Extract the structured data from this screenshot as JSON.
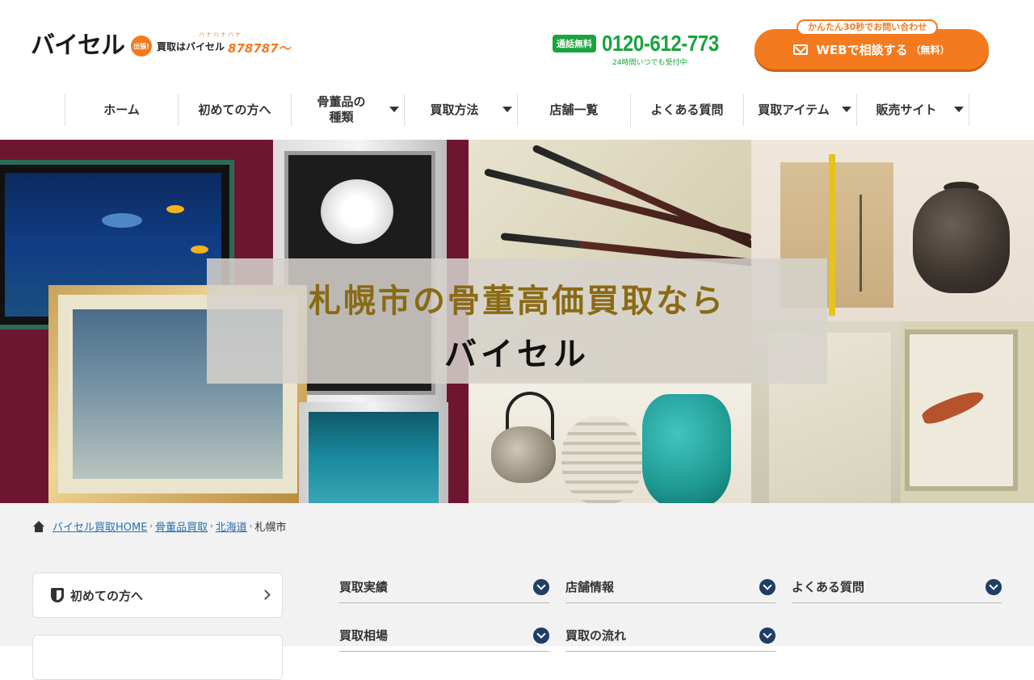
{
  "header": {
    "logo": "バイセル",
    "logo_badge": "出張!",
    "logo_tagline": "買取はバイセル",
    "logo_number": "878787〜",
    "logo_reading": "ハナハナハナ",
    "tel_badge": "通話無料",
    "tel_number": "0120-612-773",
    "tel_note": "24時間いつでも受付中",
    "cta_tag": "かんたん30秒でお問い合わせ",
    "cta_label": "WEBで相談する",
    "cta_sub": "（無料）"
  },
  "nav": {
    "items": [
      {
        "label": "ホーム"
      },
      {
        "label": "初めての方へ"
      },
      {
        "label": "骨董品の種類"
      },
      {
        "label": "買取方法"
      },
      {
        "label": "店舗一覧"
      },
      {
        "label": "よくある質問"
      },
      {
        "label": "買取アイテム"
      },
      {
        "label": "販売サイト"
      }
    ]
  },
  "hero": {
    "title": "札幌市の骨董高価買取なら",
    "brand": "バイセル"
  },
  "breadcrumb": {
    "items": [
      "バイセル買取HOME",
      "骨董品買取",
      "北海道"
    ],
    "current": "札幌市",
    "separator": "›"
  },
  "sidebar": {
    "cards": [
      {
        "label": "初めての方へ"
      }
    ]
  },
  "menu": {
    "items": [
      {
        "label": "買取実績"
      },
      {
        "label": "店舗情報"
      },
      {
        "label": "よくある質問"
      },
      {
        "label": "買取相場"
      },
      {
        "label": "買取の流れ"
      }
    ]
  },
  "colors": {
    "brand_orange": "#f47a1f",
    "tel_green": "#1aa33f",
    "hero_title_gold": "#8b6a14",
    "link_blue": "#2a6fb2",
    "dropdown_navy": "#1f3d66"
  }
}
